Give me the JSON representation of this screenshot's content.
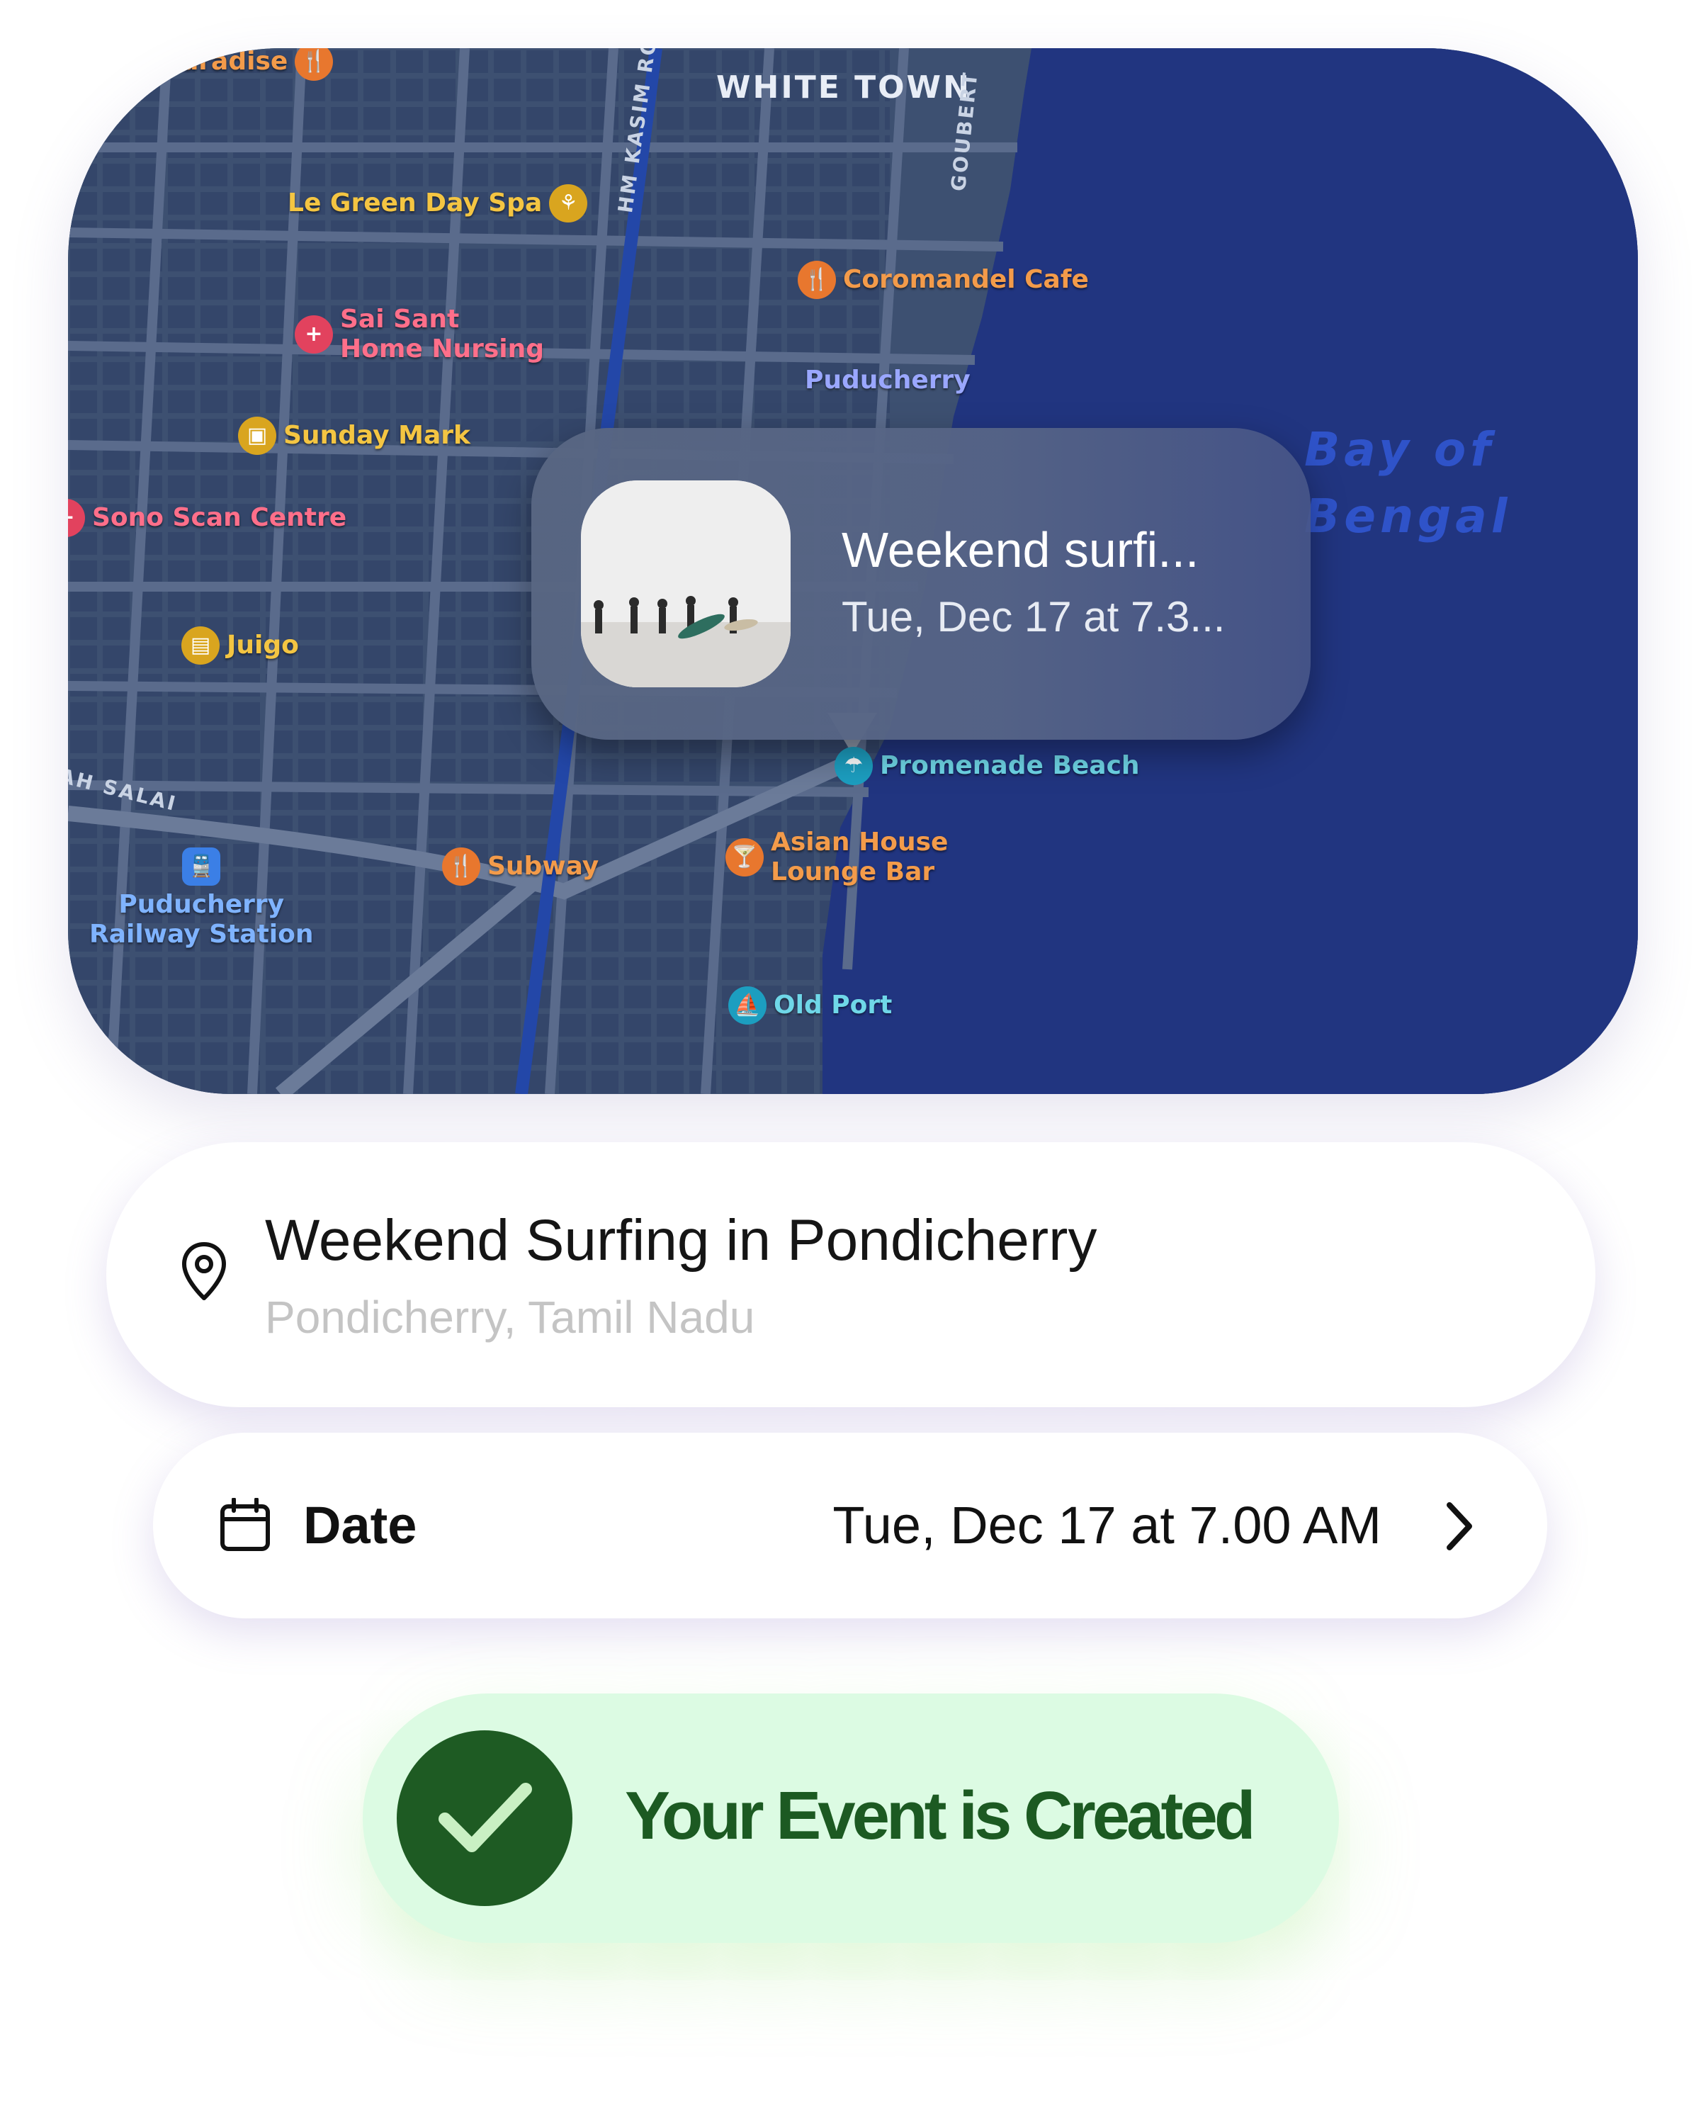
{
  "map": {
    "district": "WHITE TOWN",
    "sea_label_line1": "Bay of",
    "sea_label_line2": "Bengal",
    "streets": {
      "hm_kasim_road": "HM KASIM ROAD",
      "goubert": "GOUBERT",
      "salai": "AH SALAI"
    },
    "pois": {
      "paradise": "aradise",
      "le_green_day_spa": "Le Green Day Spa",
      "coromandel_cafe": "Coromandel Cafe",
      "sai_sant_line1": "Sai Sant",
      "sai_sant_line2": "Home Nursing",
      "puducherry_partial": "Puducherry",
      "sunday_market": "Sunday Mark",
      "sono_scan_centre": "Sono Scan Centre",
      "juigo": "Juigo",
      "promenade_beach": "Promenade Beach",
      "asian_house_line1": "Asian House",
      "asian_house_line2": "Lounge Bar",
      "subway": "Subway",
      "railway_line1": "Puducherry",
      "railway_line2": "Railway Station",
      "old_port": "Old Port"
    },
    "icons": {
      "restaurant": "fork-knife-icon",
      "spa": "spa-icon",
      "hospital": "medical-cross-icon",
      "shopping": "bag-icon",
      "basket": "basket-icon",
      "beach": "umbrella-icon",
      "bar": "cocktail-icon",
      "train": "train-icon",
      "port": "sailboat-icon"
    },
    "colors": {
      "land": "#3d5071",
      "water": "#213580"
    }
  },
  "event_pin": {
    "title": "Weekend surfi...",
    "subtitle": "Tue, Dec 17 at 7.3..."
  },
  "location": {
    "title": "Weekend Surfing in Pondicherry",
    "subtitle": "Pondicherry, Tamil Nadu",
    "icon": "map-pin-icon"
  },
  "date": {
    "label": "Date",
    "value": "Tue, Dec 17 at 7.00 AM",
    "icon": "calendar-icon"
  },
  "toast": {
    "message": "Your Event is Created",
    "icon": "checkmark-icon",
    "color": "#1e5b23"
  }
}
